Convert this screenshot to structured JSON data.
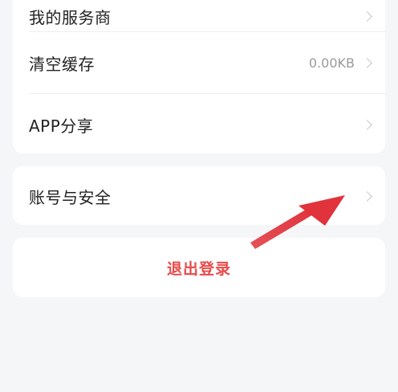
{
  "settings_list": {
    "items": [
      {
        "label": "我的服务商",
        "value": ""
      },
      {
        "label": "清空缓存",
        "value": "0.00KB"
      },
      {
        "label": "APP分享",
        "value": ""
      }
    ]
  },
  "account": {
    "label": "账号与安全"
  },
  "logout": {
    "label": "退出登录"
  },
  "colors": {
    "accent": "#e84a4a",
    "annotation_arrow": "#e0333b",
    "background": "#f5f6f8",
    "card": "#ffffff"
  },
  "annotation": {
    "icon": "red-arrow-pointing-at-account-security"
  }
}
